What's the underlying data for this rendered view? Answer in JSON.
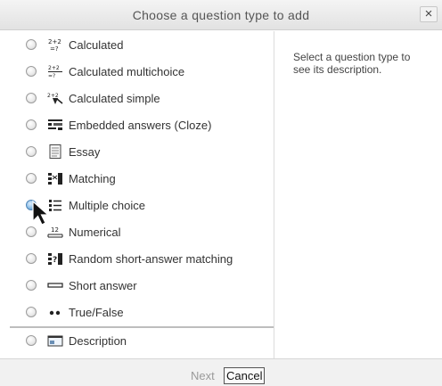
{
  "dialog": {
    "title": "Choose a question type to add",
    "close_label": "×"
  },
  "options": [
    {
      "label": "Calculated",
      "icon": "calculated-icon"
    },
    {
      "label": "Calculated multichoice",
      "icon": "calculated-multichoice-icon"
    },
    {
      "label": "Calculated simple",
      "icon": "calculated-simple-icon"
    },
    {
      "label": "Embedded answers (Cloze)",
      "icon": "cloze-icon"
    },
    {
      "label": "Essay",
      "icon": "essay-icon"
    },
    {
      "label": "Matching",
      "icon": "matching-icon"
    },
    {
      "label": "Multiple choice",
      "icon": "multiple-choice-icon"
    },
    {
      "label": "Numerical",
      "icon": "numerical-icon"
    },
    {
      "label": "Random short-answer matching",
      "icon": "random-matching-icon"
    },
    {
      "label": "Short answer",
      "icon": "short-answer-icon"
    },
    {
      "label": "True/False",
      "icon": "true-false-icon"
    },
    {
      "label": "Description",
      "icon": "description-icon"
    }
  ],
  "description": {
    "text": "Select a question type to see its description."
  },
  "footer": {
    "next_label": "Next",
    "cancel_label": "Cancel"
  },
  "colors": {
    "radio_hover": "#4a86bd",
    "next_disabled": "#9a9a9a"
  }
}
